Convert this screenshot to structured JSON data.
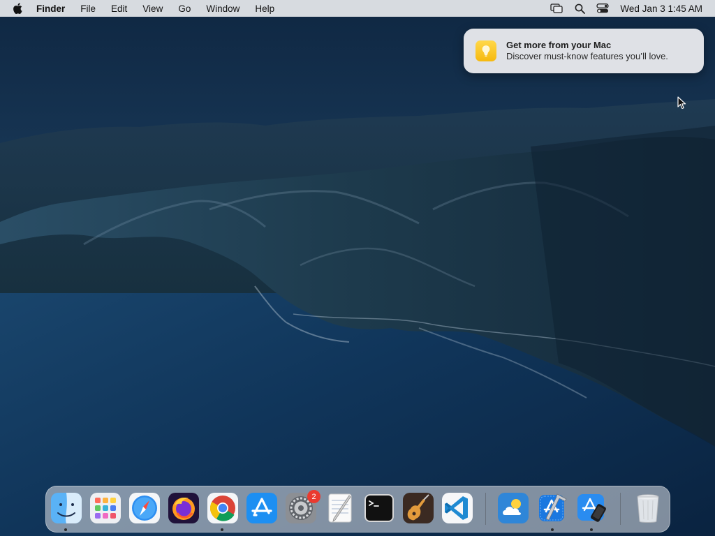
{
  "menubar": {
    "app_name": "Finder",
    "items": [
      "File",
      "Edit",
      "View",
      "Go",
      "Window"
    ],
    "help": "Help",
    "clock": "Wed Jan 3  1:45 AM",
    "status_icons": [
      "screen-mirroring-icon",
      "spotlight-search-icon",
      "control-center-icon"
    ]
  },
  "notification": {
    "title": "Get more from your Mac",
    "body": "Discover must-know features you’ll love.",
    "icon": "lightbulb-icon"
  },
  "dock": {
    "apps": [
      "Finder",
      "Launchpad",
      "Safari",
      "Firefox",
      "Google Chrome",
      "App Store",
      "System Settings",
      "TextEdit",
      "Terminal",
      "GarageBand",
      "Visual Studio Code",
      "Weather",
      "Xcode",
      "Simulator",
      "Trash"
    ],
    "system_settings_badge": "2",
    "running": [
      "Finder",
      "Google Chrome",
      "Xcode",
      "Simulator"
    ]
  },
  "colors": {
    "menubar": "#e8eaee",
    "badge": "#ea3a2f",
    "wallpaper_sky": "#1a3a5e",
    "wallpaper_sea": "#0e2c4c"
  }
}
